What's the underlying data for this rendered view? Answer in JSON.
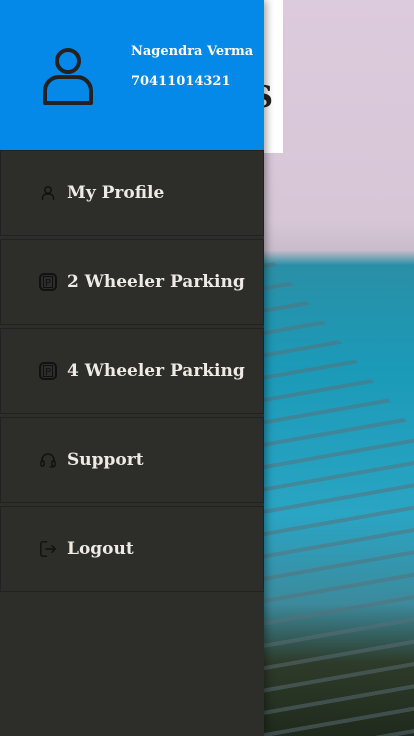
{
  "user": {
    "name": "Nagendra Verma",
    "phone": "70411014321"
  },
  "background_card": {
    "logo_letter": "S"
  },
  "menu": [
    {
      "label": "My Profile",
      "icon": "person-icon"
    },
    {
      "label": "2 Wheeler Parking",
      "icon": "parking-icon"
    },
    {
      "label": "4 Wheeler Parking",
      "icon": "parking-icon"
    },
    {
      "label": "Support",
      "icon": "headset-icon"
    },
    {
      "label": "Logout",
      "icon": "logout-icon"
    }
  ],
  "colors": {
    "header": "#0489e8",
    "drawer": "#2d2d29"
  }
}
